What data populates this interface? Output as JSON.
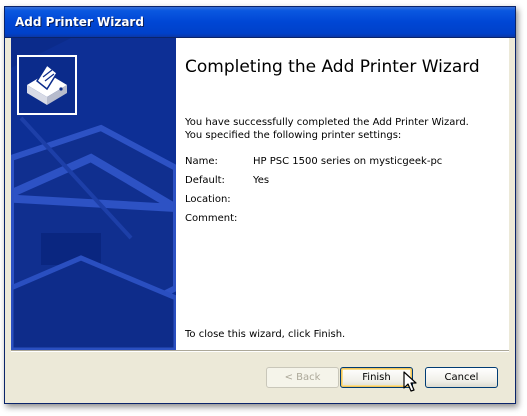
{
  "window": {
    "title": "Add Printer Wizard"
  },
  "page": {
    "heading": "Completing the Add Printer Wizard",
    "desc_line1": "You have successfully completed the Add Printer Wizard.",
    "desc_line2": "You specified the following printer settings:",
    "settings": [
      {
        "label": "Name:",
        "value": "HP PSC 1500 series on mysticgeek-pc"
      },
      {
        "label": "Default:",
        "value": "Yes"
      },
      {
        "label": "Location:",
        "value": ""
      },
      {
        "label": "Comment:",
        "value": ""
      }
    ],
    "closing": "To close this wizard, click Finish."
  },
  "buttons": {
    "back": "< Back",
    "finish": "Finish",
    "cancel": "Cancel"
  },
  "icons": {
    "wizard": "printer-wizard-icon",
    "cursor": "mouse-pointer-icon"
  },
  "colors": {
    "banner": "#0b2b8b",
    "titlebar": "#0046d5",
    "dialog": "#ece9d8"
  }
}
